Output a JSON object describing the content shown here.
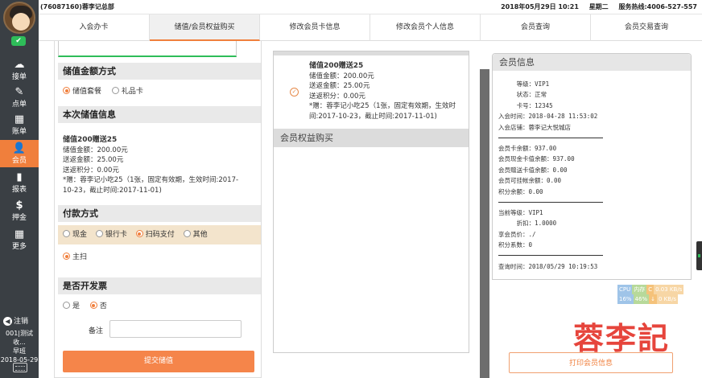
{
  "topbar": {
    "store_title": "(76087160)蓉李记总部",
    "date": "2018年05月29日 10:21",
    "weekday": "星期二",
    "hotline": "服务热线:4006-527-557"
  },
  "sidebar": {
    "nav": [
      {
        "icon": "☁",
        "label": "接单"
      },
      {
        "icon": "✎",
        "label": "点单"
      },
      {
        "icon": "▦",
        "label": "账单"
      },
      {
        "icon": "👤",
        "label": "会员"
      },
      {
        "icon": "▮",
        "label": "报表"
      },
      {
        "icon": "$",
        "label": "押金"
      },
      {
        "icon": "▦",
        "label": "更多"
      }
    ],
    "logout_label": "注销",
    "user_line": "001|测试收...",
    "shift": "早班",
    "date": "2018-05-29"
  },
  "tabs": [
    "入会办卡",
    "储值/会员权益购买",
    "修改会员卡信息",
    "修改会员个人信息",
    "会员查询",
    "会员交易查询"
  ],
  "form": {
    "stored_value_method": {
      "title": "储值金额方式",
      "options": [
        "储值套餐",
        "礼品卡"
      ]
    },
    "this_stored": {
      "title": "本次储值信息",
      "name": "储值200赠送25",
      "line1": "储值金额：200.00元",
      "line2": "送返金额：25.00元",
      "line3": "送返积分：0.00元",
      "line4": "*赠：蓉李记小吃25（1张，固定有效期，生效时间:2017-",
      "line5": "10-23，截止时间:2017-11-01)"
    },
    "payment": {
      "title": "付款方式",
      "options": [
        "现金",
        "银行卡",
        "扫码支付",
        "其他"
      ],
      "sub_option": "主扫"
    },
    "invoice": {
      "title": "是否开发票",
      "options": [
        "是",
        "否"
      ],
      "remark_label": "备注"
    },
    "submit_label": "提交储值"
  },
  "middle": {
    "package": {
      "name": "储值200赠送25",
      "line1": "储值金额：200.00元",
      "line2": "送返金额：25.00元",
      "line3": "送返积分：0.00元",
      "line4": "*赠：蓉李记小吃25（1张，固定有效期，生效时",
      "line5": "间:2017-10-23，截止时间:2017-11-01)"
    },
    "rights_title": "会员权益购买"
  },
  "member": {
    "title": "会员信息",
    "block1": "     等级：VIP1\n     状态：正常\n     卡号：12345\n入会时间：2018-04-28 11:53:02\n入会店铺：蓉李记大悦城店",
    "block2": "会员卡余额：937.00\n会员现金卡值余额：937.00\n会员赠送卡值余额：0.00\n会员可挂帐余额：0.00\n积分余额：0.00",
    "block3": "当前等级：VIP1\n     折扣：1.0000\n享会员价：./\n积分系数：0",
    "block4": "查询时间：2018/05/29 10:19:53",
    "print_label": "打印会员信息"
  },
  "monitor": {
    "row1": [
      "CPU",
      "内存",
      "C",
      "0.03 KB/s"
    ],
    "row2": [
      "16%",
      "46%",
      "↓",
      "0 KB/s"
    ]
  },
  "brand_text": "蓉李記",
  "colors": {
    "accent": "#f07f3c",
    "sidebar_bg": "#3a3f44",
    "success": "#2ebd59",
    "brand_red": "#e6453c"
  }
}
